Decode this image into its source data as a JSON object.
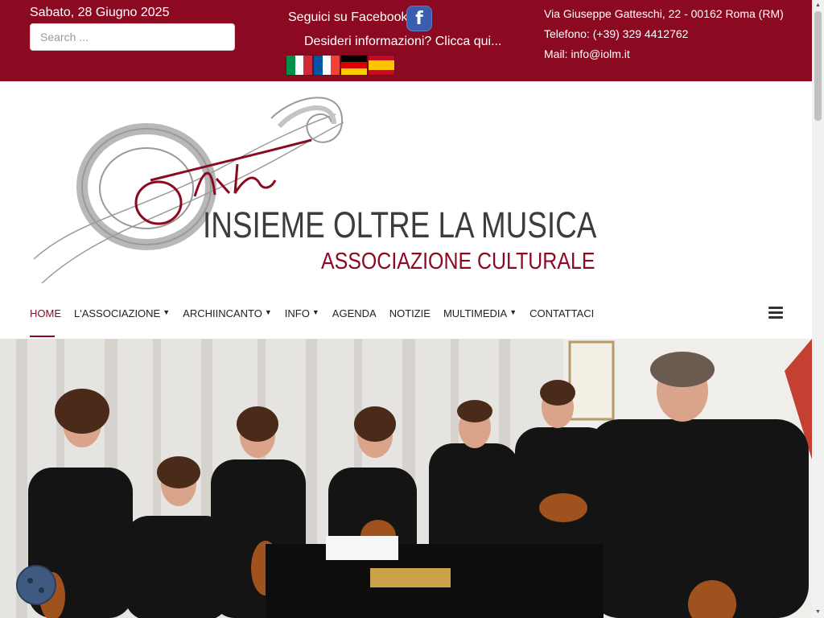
{
  "topbar": {
    "date": "Sabato, 28 Giugno 2025",
    "search_placeholder": "Search ...",
    "facebook_text": "Seguici su Facebook",
    "facebook_glyph": "f",
    "info_link": "Desideri informazioni? Clicca qui...",
    "flags": [
      {
        "name": "italian",
        "colors": [
          "#009246",
          "#ffffff",
          "#ce2b37"
        ]
      },
      {
        "name": "french",
        "colors": [
          "#0055a4",
          "#ffffff",
          "#ef4135"
        ]
      },
      {
        "name": "german",
        "colors": [
          "#000000",
          "#dd0000",
          "#ffce00"
        ]
      },
      {
        "name": "spanish",
        "colors": [
          "#c60b1e",
          "#ffc400",
          "#c60b1e"
        ]
      }
    ],
    "address": "Via Giuseppe Gatteschi, 22 - 00162 Roma (RM)",
    "phone": "Telefono: (+39) 329 4412762",
    "mail": "Mail: info@iolm.it",
    "background": "#8b0a22"
  },
  "logo": {
    "script": "Oltre",
    "title": "INSIEME OLTRE LA MUSICA",
    "subtitle": "ASSOCIAZIONE CULTURALE",
    "accent": "#8b0a22",
    "title_color": "#3c3c3c"
  },
  "nav": {
    "items": [
      {
        "label": "HOME",
        "dropdown": false,
        "active": true
      },
      {
        "label": "L'ASSOCIAZIONE",
        "dropdown": true,
        "active": false
      },
      {
        "label": "ARCHIINCANTO",
        "dropdown": true,
        "active": false
      },
      {
        "label": "INFO",
        "dropdown": true,
        "active": false
      },
      {
        "label": "AGENDA",
        "dropdown": false,
        "active": false
      },
      {
        "label": "NOTIZIE",
        "dropdown": false,
        "active": false
      },
      {
        "label": "MULTIMEDIA",
        "dropdown": true,
        "active": false
      },
      {
        "label": "CONTATTACI",
        "dropdown": false,
        "active": false
      }
    ],
    "caret_glyph": "▼",
    "menu_icon": "hamburger-menu-icon"
  },
  "hero": {
    "image": "group-photo-musicians-with-violins"
  },
  "cookie_icon": "cookie-icon"
}
